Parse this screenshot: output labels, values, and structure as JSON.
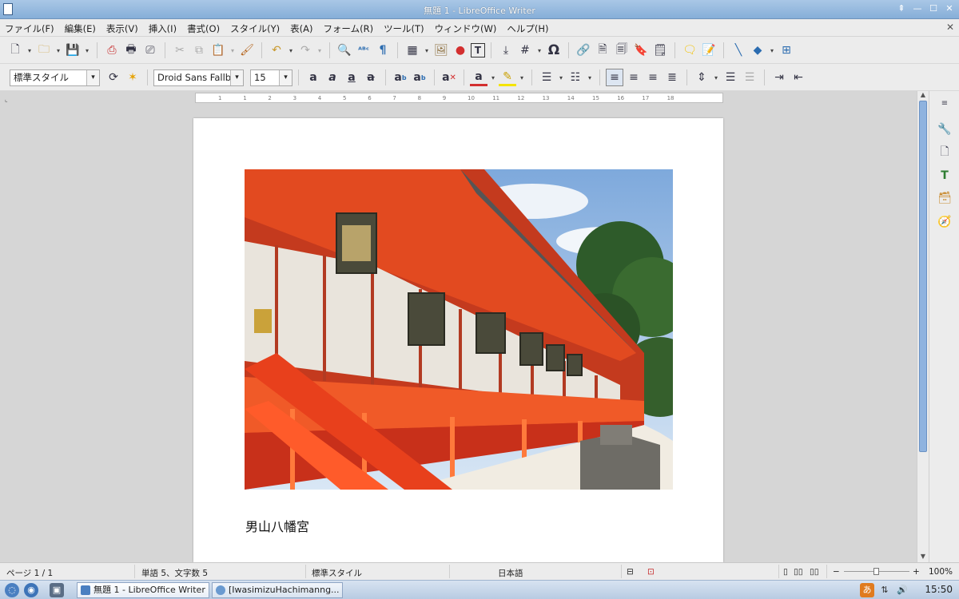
{
  "window": {
    "title": "無題 1 - LibreOffice Writer"
  },
  "menu": [
    "ファイル(F)",
    "編集(E)",
    "表示(V)",
    "挿入(I)",
    "書式(O)",
    "スタイル(Y)",
    "表(A)",
    "フォーム(R)",
    "ツール(T)",
    "ウィンドウ(W)",
    "ヘルプ(H)"
  ],
  "formatting": {
    "paragraph_style": "標準スタイル",
    "font_name": "Droid Sans Fallba",
    "font_size": "15"
  },
  "ruler": {
    "labels": [
      "1",
      "1",
      "2",
      "3",
      "4",
      "5",
      "6",
      "7",
      "8",
      "9",
      "10",
      "11",
      "12",
      "13",
      "14",
      "15",
      "16",
      "17",
      "18"
    ]
  },
  "document": {
    "caption": "男山八幡宮"
  },
  "statusbar": {
    "page": "ページ 1 / 1",
    "words": "単語 5、文字数 5",
    "style": "標準スタイル",
    "language": "日本語",
    "zoom": "100%"
  },
  "taskbar": {
    "task1": "無題 1 - LibreOffice Writer",
    "task2": "[IwasimizuHachimanng...",
    "clock": "15:50",
    "ime_icon": "あ"
  },
  "colors": {
    "accent": "#86aed8",
    "shrine_red": "#e8401c",
    "sky": "#9fc3ec"
  }
}
